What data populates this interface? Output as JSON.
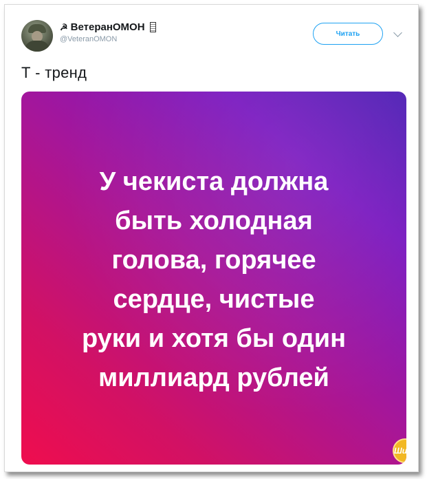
{
  "tweet": {
    "display_name": "ВетеранОМОН",
    "name_prefix_icon": "sickle-icon",
    "name_suffix_icon": "flag-icon",
    "handle": "@VeteranOMON",
    "follow_label": "Читать",
    "text": "Т - тренд"
  },
  "media": {
    "caption_lines": [
      "У чекиста должна",
      "быть холодная",
      "голова, горячее",
      "сердце, чистые",
      "руки и хотя бы один",
      "миллиард рублей"
    ],
    "watermark": "Шика",
    "gradient_colors": [
      "#ef0d4e",
      "#a5169a",
      "#4f22b5"
    ]
  },
  "colors": {
    "accent": "#1da1f2",
    "secondary_text": "#8a9aa8",
    "primary_text": "#14171a"
  }
}
